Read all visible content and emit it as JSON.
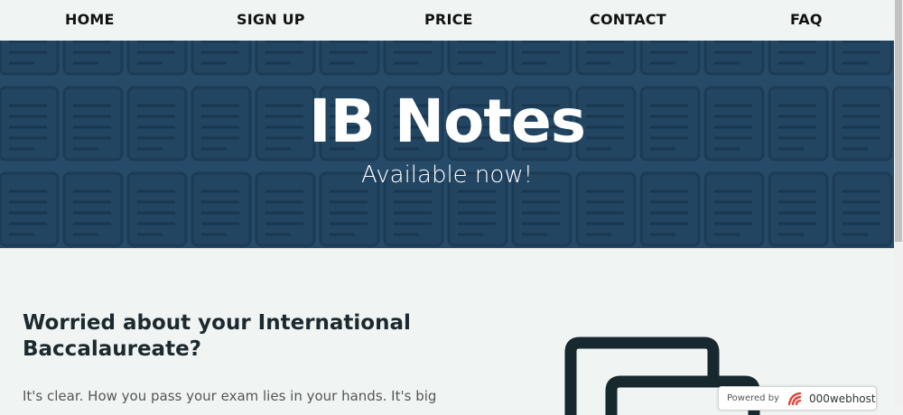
{
  "nav": {
    "items": [
      {
        "label": "HOME"
      },
      {
        "label": "SIGN UP"
      },
      {
        "label": "PRICE"
      },
      {
        "label": "CONTACT"
      },
      {
        "label": "FAQ"
      }
    ]
  },
  "hero": {
    "title": "IB Notes",
    "subtitle": "Available now!",
    "background_color": "#264b69",
    "pattern_icon": "notepad-icon"
  },
  "content": {
    "heading": "Worried about your International Baccalaureate?",
    "paragraph": "It's clear. How you pass your exam lies in your hands. It's big"
  },
  "illustration": {
    "icon": "documents-stack-icon"
  },
  "badge": {
    "powered_label": "Powered by",
    "brand": "000webhost",
    "logo_icon": "000webhost-logo-icon"
  },
  "colors": {
    "page_bg": "#f0f5f4",
    "hero_bg": "#264b69",
    "heading_text": "#1c2a30"
  }
}
